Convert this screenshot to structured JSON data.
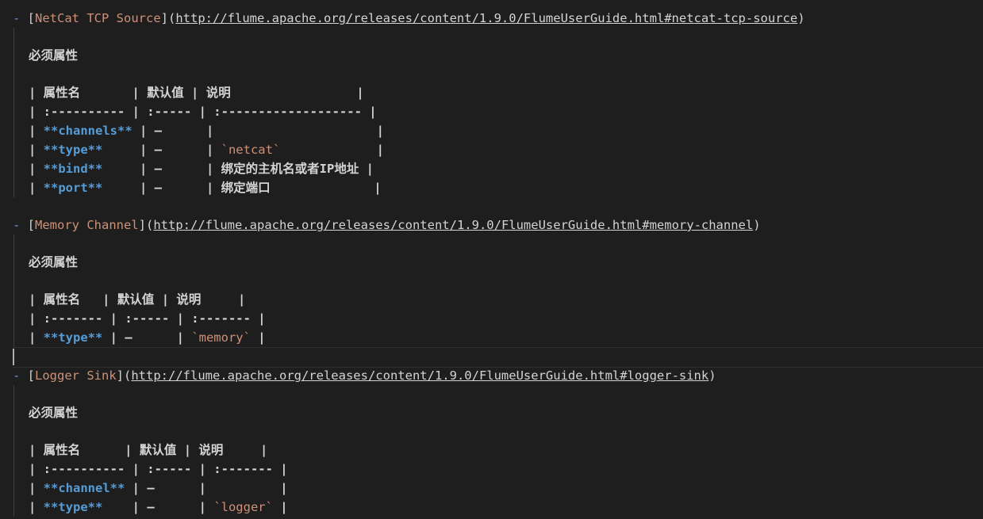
{
  "sections": [
    {
      "link_text": "NetCat TCP Source",
      "url": "http://flume.apache.org/releases/content/1.9.0/FlumeUserGuide.html#netcat-tcp-source",
      "heading": "必须属性",
      "rows": [
        "| 属性名       | 默认值 | 说明                 |",
        "| :---------- | :----- | :------------------- |",
        "| **channels** | –      |                      |",
        "| **type**     | –      | `netcat`             |",
        "| **bind**     | –      | 绑定的主机名或者IP地址 |",
        "| **port**     | –      | 绑定端口              |"
      ]
    },
    {
      "link_text": "Memory Channel",
      "url": "http://flume.apache.org/releases/content/1.9.0/FlumeUserGuide.html#memory-channel",
      "heading": "必须属性",
      "rows": [
        "| 属性名   | 默认值 | 说明     |",
        "| :------- | :----- | :------- |",
        "| **type** | –      | `memory` |"
      ]
    },
    {
      "link_text": "Logger Sink",
      "url": "http://flume.apache.org/releases/content/1.9.0/FlumeUserGuide.html#logger-sink",
      "heading": "必须属性",
      "rows": [
        "| 属性名      | 默认值 | 说明     |",
        "| :---------- | :----- | :------- |",
        "| **channel** | –      |          |",
        "| **type**    | –      | `logger` |"
      ]
    }
  ]
}
